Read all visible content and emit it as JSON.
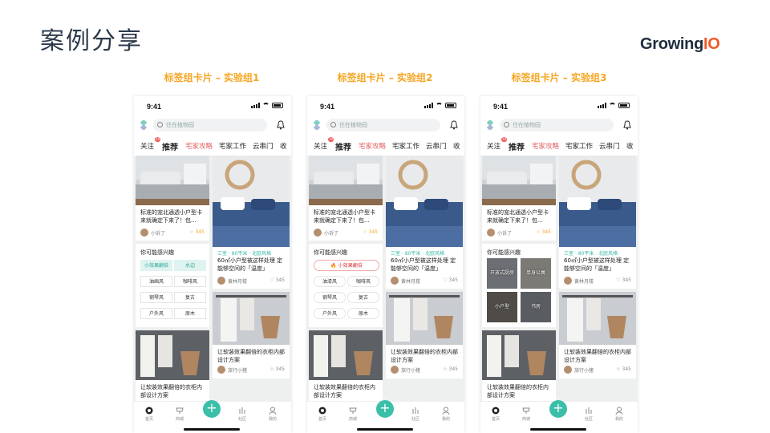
{
  "slide": {
    "title": "案例分享",
    "logo_main": "Growing",
    "logo_accent": "IO",
    "groups": [
      "标签组卡片 – 实验组1",
      "标签组卡片 – 实验组2",
      "标签组卡片 – 实验组3"
    ]
  },
  "phone": {
    "time": "9:41",
    "search_placeholder": "住在植物园",
    "tabs": [
      "关注",
      "推荐",
      "宅家攻略",
      "宅家工作",
      "云串门",
      "收"
    ],
    "tab_badge": "19",
    "cards": {
      "c1": {
        "title": "标准的宠北通透小户型卡来就确定下来了！包...",
        "author": "小诉了",
        "likes": "345"
      },
      "c2": {
        "tag": "三室 · 80平米 · 北欧风格",
        "title": "60㎡小户型被这样处理 定能够空间的「温度」",
        "author": "黄林月楼",
        "likes": "345"
      },
      "c3": {
        "title": "让软装效果翻倍的衣柜内部设计方案",
        "author": "旅行小猪",
        "likes": "345"
      },
      "c4": {
        "title": "让软装效果翻倍的衣柜内部设计方案"
      }
    },
    "rec_title": "你可能感兴趣",
    "chips_v1": [
      "小效果翻倍",
      "水边",
      "油画风",
      "咖啡风",
      "钢琴风",
      "复古",
      "户外风",
      "原木"
    ],
    "chips_v2": [
      "小效果翻倍",
      "油漆风",
      "咖啡风",
      "钢琴风",
      "复古",
      "户外风",
      "原木"
    ],
    "tiles_v3": [
      "开放式厨房",
      "单身公寓",
      "小户型",
      "书房"
    ],
    "tabbar": [
      "首页",
      "商城",
      "社区",
      "我的"
    ]
  },
  "colors": {
    "accent": "#3bbfa8",
    "group_title": "#f5a623",
    "logo_io": "#f15a29"
  }
}
